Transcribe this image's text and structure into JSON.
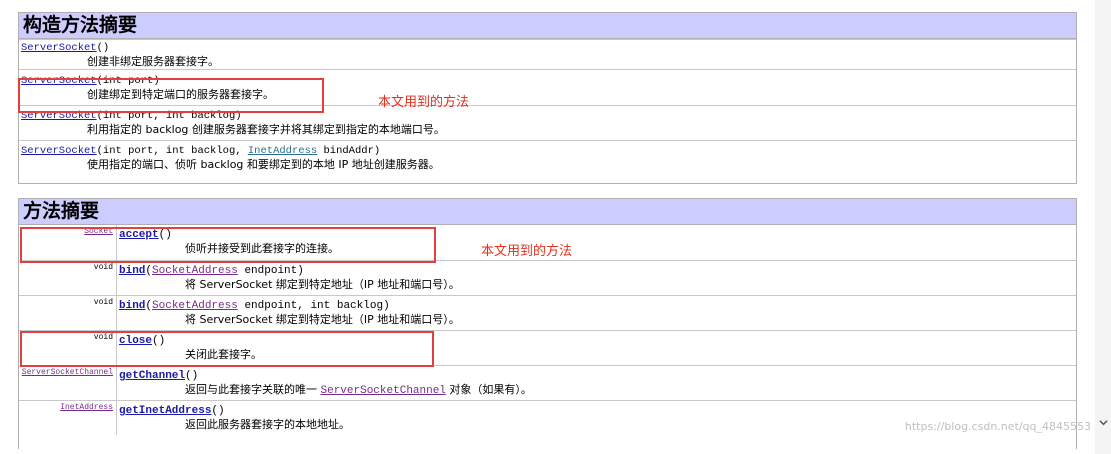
{
  "constructors": {
    "title": "构造方法摘要",
    "rows": [
      {
        "name": "ServerSocket",
        "params": "()",
        "params_extra": "",
        "desc": "创建非绑定服务器套接字。"
      },
      {
        "name": "ServerSocket",
        "params": "(int port)",
        "params_extra": "",
        "desc": "创建绑定到特定端口的服务器套接字。"
      },
      {
        "name": "ServerSocket",
        "params": "(int port, int backlog)",
        "params_extra": "",
        "desc": "利用指定的 backlog 创建服务器套接字并将其绑定到指定的本地端口号。"
      },
      {
        "name": "ServerSocket",
        "params": "(int port, int backlog, ",
        "link": "InetAddress",
        "params_extra": " bindAddr)",
        "desc": "使用指定的端口、侦听 backlog 和要绑定到的本地 IP 地址创建服务器。"
      }
    ]
  },
  "methods": {
    "title": "方法摘要",
    "rows": [
      {
        "type": "Socket",
        "name": "accept",
        "params": "()",
        "desc": "侦听并接受到此套接字的连接。"
      },
      {
        "type": "void",
        "name": "bind",
        "params_pre": "(",
        "link": "SocketAddress",
        "params_post": " endpoint)",
        "desc": "将 ServerSocket 绑定到特定地址（IP 地址和端口号）。"
      },
      {
        "type": "void",
        "name": "bind",
        "params_pre": "(",
        "link": "SocketAddress",
        "params_post": " endpoint, int backlog)",
        "desc": "将 ServerSocket 绑定到特定地址（IP 地址和端口号）。"
      },
      {
        "type": "void",
        "name": "close",
        "params": "()",
        "desc": "关闭此套接字。"
      },
      {
        "type": "ServerSocketChannel",
        "name": "getChannel",
        "params": "()",
        "desc_pre": "返回与此套接字关联的唯一 ",
        "link": "ServerSocketChannel",
        "desc_post": " 对象（如果有）。"
      },
      {
        "type": "InetAddress",
        "name": "getInetAddress",
        "params": "()",
        "desc": "返回此服务器套接字的本地地址。"
      }
    ]
  },
  "annotations": {
    "constructor_note": "本文用到的方法",
    "method_note": "本文用到的方法"
  },
  "watermark": "https://blog.csdn.net/qq_4845553",
  "colors": {
    "header_bg": "#ccccff",
    "highlight": "#e04040",
    "note": "#e03020"
  }
}
